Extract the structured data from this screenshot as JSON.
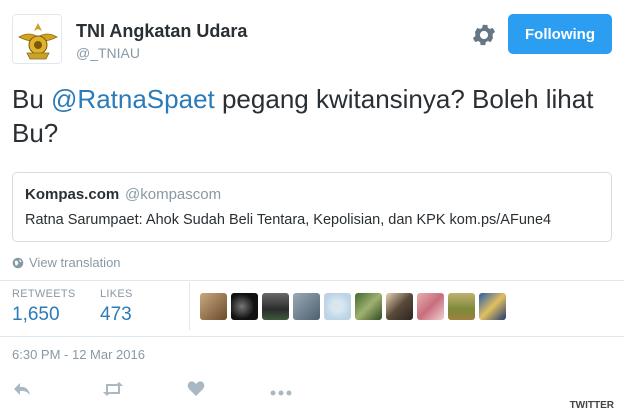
{
  "account": {
    "display_name": "TNI Angkatan Udara",
    "username": "@_TNIAU",
    "follow_label": "Following"
  },
  "tweet": {
    "text_before": "Bu ",
    "mention": "@RatnaSpaet",
    "text_after": " pegang kwitansinya? Boleh lihat Bu?"
  },
  "quote": {
    "name": "Kompas.com",
    "handle": "@kompascom",
    "text": "Ratna Sarumpaet: Ahok Sudah Beli Tentara, Kepolisian, dan KPK kom.ps/AFune4"
  },
  "translate_label": "View translation",
  "stats": {
    "retweets_label": "RETWEETS",
    "retweets_value": "1,650",
    "likes_label": "LIKES",
    "likes_value": "473"
  },
  "timestamp": "6:30 PM - 12 Mar 2016",
  "watermark": "TWITTER",
  "colors": {
    "accent": "#2b9ef2",
    "link": "#2b7bb9",
    "muted": "#8899a6",
    "text": "#292f33"
  },
  "icons": {
    "settings": "gear-icon",
    "translate": "globe-icon",
    "reply": "reply-icon",
    "retweet": "retweet-icon",
    "like": "heart-icon",
    "more": "more-icon"
  }
}
